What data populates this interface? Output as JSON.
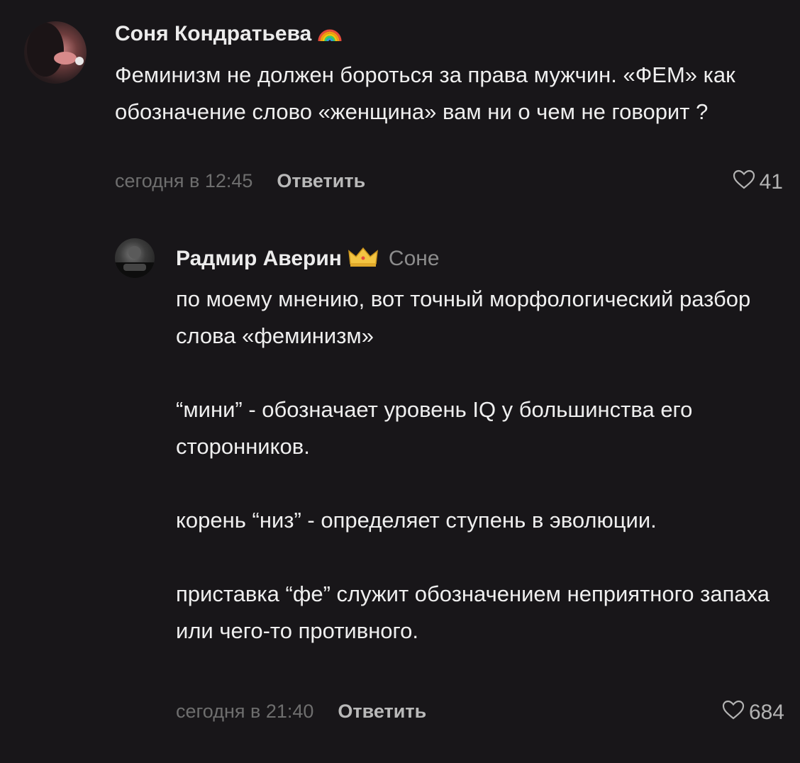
{
  "comments": [
    {
      "author": "Соня Кондратьева",
      "badge_icon": "rainbow-icon",
      "lines": [
        "Феминизм не должен бороться за права мужчин. «ФЕМ» как обозначение слово «женщина» вам ни о чем не говорит ?"
      ],
      "time": "сегодня в 12:45",
      "reply_label": "Ответить",
      "likes": "41"
    },
    {
      "author": "Радмир Аверин",
      "badge_icon": "crown-icon",
      "reply_to": "Соне",
      "paragraphs": [
        "по моему мнению, вот точный морфологический разбор слова «феминизм»",
        "“мини” - обозначает уровень IQ у большинства его сторонников.",
        "корень “низ” - определяет ступень в эволюции.",
        "приставка “фе” служит обозначением неприятного запаха или чего-то противного."
      ],
      "time": "сегодня в 21:40",
      "reply_label": "Ответить",
      "likes": "684"
    }
  ],
  "colors": {
    "background": "#181619",
    "text": "#efefef",
    "muted": "#6e6e6e"
  }
}
